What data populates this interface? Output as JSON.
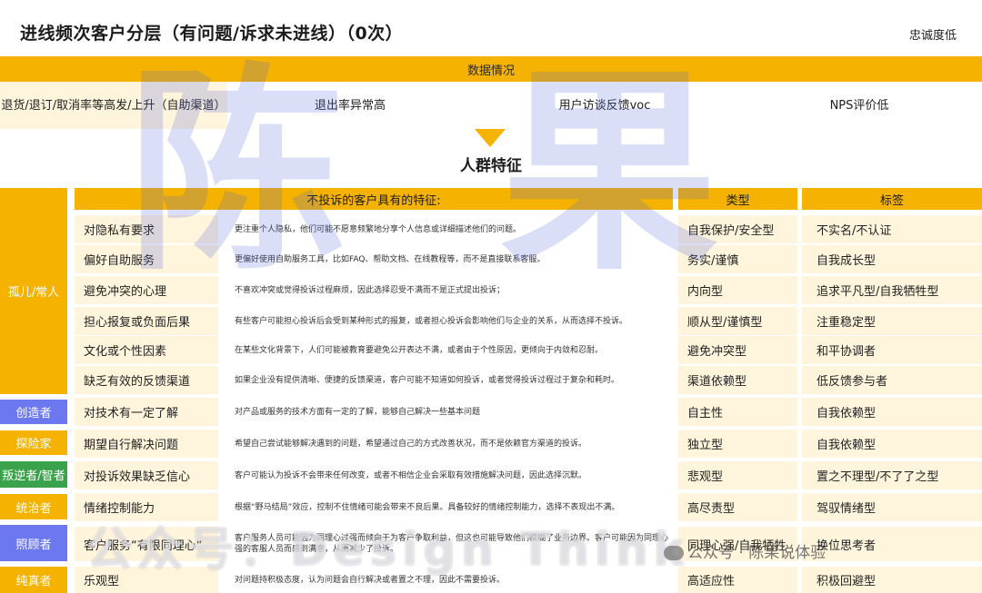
{
  "header": {
    "title": "进线频次客户分层（有问题/诉求未进线）（0次）",
    "loyalty": "忠诚度低"
  },
  "data_section": {
    "title": "数据情况",
    "cells": [
      "退货/退订/取消率等高发/上升（自助渠道）",
      "退出率异常高",
      "用户访谈反馈voc",
      "NPS评价低"
    ]
  },
  "crowd": {
    "title": "人群特征",
    "col_features": "不投诉的客户具有的特征:",
    "col_type": "类型",
    "col_tag": "标签"
  },
  "groups": [
    {
      "label": "孤儿/常人",
      "color": "#f5b300"
    },
    {
      "label": "创造者",
      "color": "#6c78f0"
    },
    {
      "label": "探险家",
      "color": "#f5b300"
    },
    {
      "label": "叛逆者/智者",
      "color": "#3aa24a"
    },
    {
      "label": "统治者",
      "color": "#f5b300"
    },
    {
      "label": "照顾者",
      "color": "#6c78f0"
    },
    {
      "label": "纯真者",
      "color": "#f5b300"
    }
  ],
  "rows": [
    {
      "feature": "对隐私有要求",
      "desc": "更注重个人隐私，他们可能不愿意频繁地分享个人信息或详细描述他们的问题。",
      "type": "自我保护/安全型",
      "tag": "不实名/不认证"
    },
    {
      "feature": "偏好自助服务",
      "desc": "更偏好使用自助服务工具，比如FAQ、帮助文档、在线教程等，而不是直接联系客服。",
      "type": "务实/谨慎",
      "tag": "自我成长型"
    },
    {
      "feature": "避免冲突的心理",
      "desc": "不喜欢冲突或觉得投诉过程麻烦，因此选择忍受不满而不是正式提出投诉；",
      "type": "内向型",
      "tag": "追求平凡型/自我牺牲型"
    },
    {
      "feature": "担心报复或负面后果",
      "desc": "有些客户可能担心投诉后会受到某种形式的报复，或者担心投诉会影响他们与企业的关系，从而选择不投诉。",
      "type": "顺从型/谨慎型",
      "tag": "注重稳定型"
    },
    {
      "feature": "文化或个性因素",
      "desc": "在某些文化背景下，人们可能被教育要避免公开表达不满，或者由于个性原因，更倾向于内敛和忍耐。",
      "type": "避免冲突型",
      "tag": "和平协调者"
    },
    {
      "feature": "缺乏有效的反馈渠道",
      "desc": "如果企业没有提供清晰、便捷的反馈渠道，客户可能不知道如何投诉，或者觉得投诉过程过于复杂和耗时。",
      "type": "渠道依赖型",
      "tag": "低反馈参与者"
    },
    {
      "feature": "对技术有一定了解",
      "desc": "对产品或服务的技术方面有一定的了解，能够自己解决一些基本问题",
      "type": "自主性",
      "tag": "自我依赖型"
    },
    {
      "feature": "期望自行解决问题",
      "desc": "希望自己尝试能够解决遇到的问题，希望通过自己的方式改善状况，而不是依赖官方渠道的投诉。",
      "type": "独立型",
      "tag": "自我依赖型"
    },
    {
      "feature": "对投诉效果缺乏信心",
      "desc": "客户可能认为投诉不会带来任何改变，或者不相信企业会采取有效措施解决问题，因此选择沉默。",
      "type": "悲观型",
      "tag": "置之不理型/不了了之型"
    },
    {
      "feature": "情绪控制能力",
      "desc": "根据“野马结局”效应，控制不住情绪可能会带来不良后果。具备较好的情绪控制能力，选择不表现出不满。",
      "type": "高尽责型",
      "tag": "驾驭情绪型"
    },
    {
      "feature": "客户服务“有限同理心”",
      "desc": "客户服务人员可能因为同理心过强而倾向于为客户争取利益，但这也可能导致他们模糊了业务边界。客户可能因为同理心强的客服人员而感到满意，从而减少了投诉。",
      "type": "同理心强/自我牺牲",
      "tag": "换位思考者"
    },
    {
      "feature": "乐观型",
      "desc": "对问题持积极态度，认为问题会自行解决或者置之不理，因此不需要投诉。",
      "type": "高适应性",
      "tag": "积极回避型"
    }
  ],
  "watermark": {
    "big": "陈果",
    "design": "公众号：Design Think",
    "credit": "公众号 · 陈果说体验"
  }
}
